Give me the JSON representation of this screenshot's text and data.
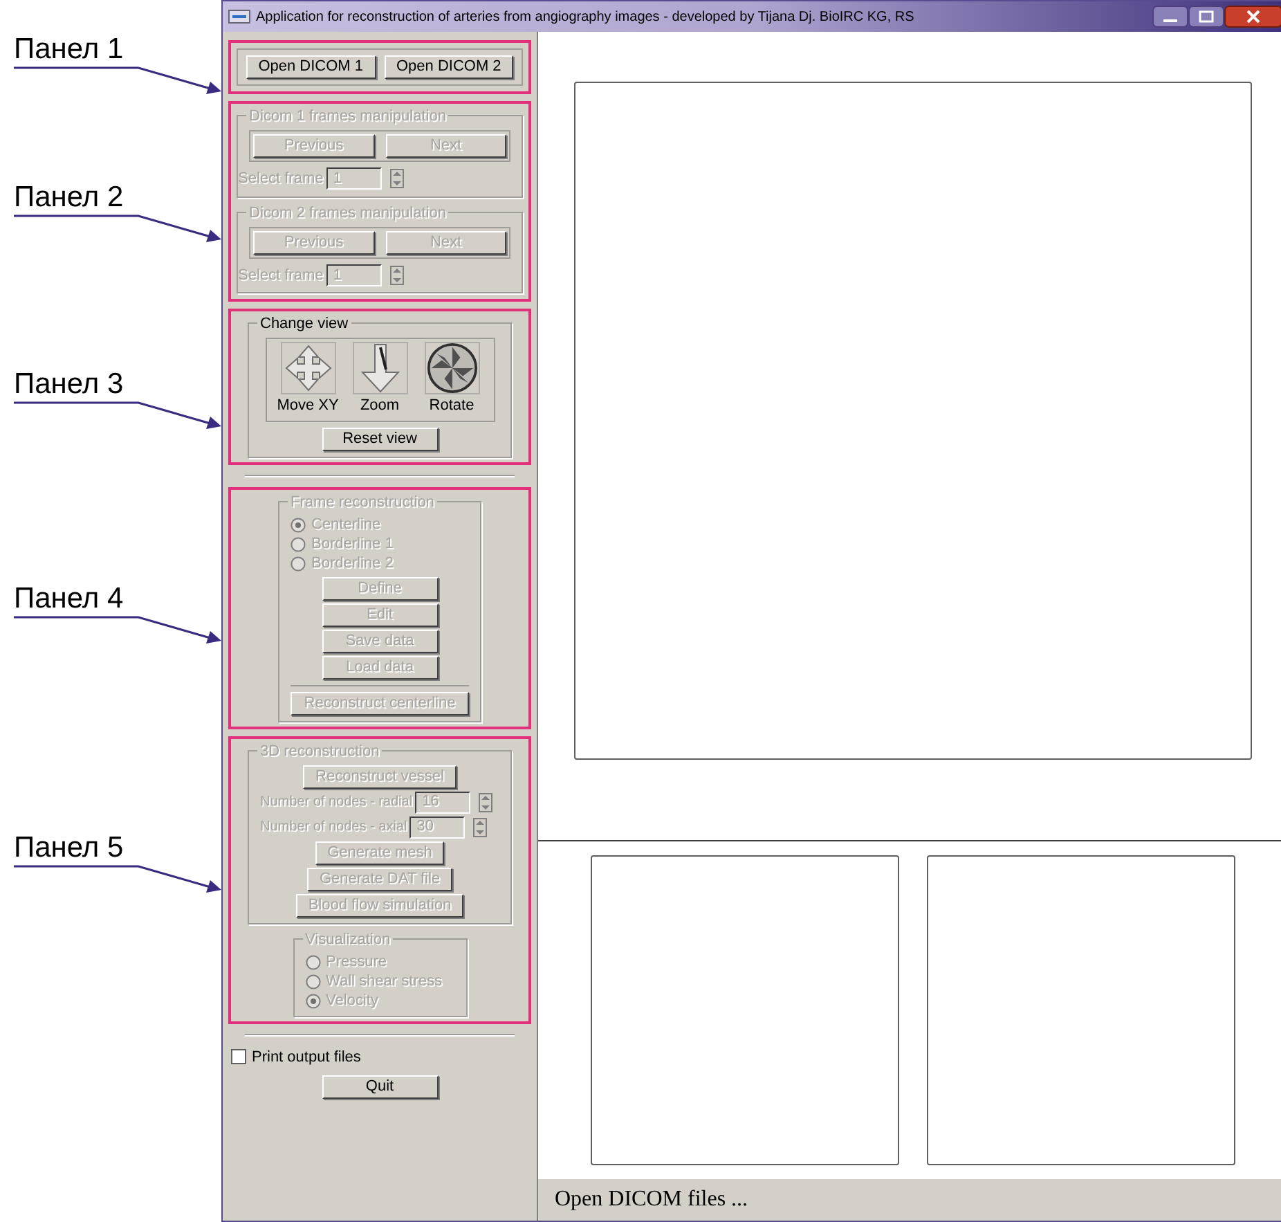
{
  "annotations": [
    {
      "label": "Панел 1"
    },
    {
      "label": "Панел 2"
    },
    {
      "label": "Панел 3"
    },
    {
      "label": "Панел 4"
    },
    {
      "label": "Панел 5"
    }
  ],
  "window": {
    "title": "Application for reconstruction of arteries from angiography images - developed by Tijana Dj. BioIRC KG, RS"
  },
  "open_buttons": [
    "Open DICOM 1",
    "Open DICOM 2"
  ],
  "frame_groups": [
    {
      "title": "Dicom 1 frames manipulation",
      "disabled": true,
      "buttons": [
        "Previous",
        "Next"
      ],
      "select_label": "Select frame",
      "value": "1"
    },
    {
      "title": "Dicom 2 frames manipulation",
      "disabled": true,
      "buttons": [
        "Previous",
        "Next"
      ],
      "select_label": "Select frame",
      "value": "1"
    }
  ],
  "change_view": {
    "title": "Change view",
    "tools": [
      {
        "kind": "move",
        "label": "Move XY"
      },
      {
        "kind": "zoom",
        "label": "Zoom"
      },
      {
        "kind": "rotate",
        "label": "Rotate"
      }
    ],
    "reset": "Reset view"
  },
  "frame_reconstruction": {
    "title": "Frame reconstruction",
    "disabled": true,
    "options": [
      {
        "label": "Centerline",
        "selected": true
      },
      {
        "label": "Borderline 1",
        "selected": false
      },
      {
        "label": "Borderline 2",
        "selected": false
      }
    ],
    "buttons": [
      "Define",
      "Edit",
      "Save data",
      "Load data"
    ],
    "reconstruct": "Reconstruct centerline"
  },
  "reconstruction_3d": {
    "title": "3D reconstruction",
    "disabled": true,
    "reconstruct": "Reconstruct vessel",
    "nodes": [
      {
        "label": "Number of nodes - radial",
        "value": "16"
      },
      {
        "label": "Number of nodes - axial",
        "value": "30"
      }
    ],
    "buttons": [
      "Generate mesh",
      "Generate DAT file",
      "Blood flow simulation"
    ]
  },
  "visualization": {
    "title": "Visualization",
    "disabled": true,
    "options": [
      {
        "label": "Pressure",
        "selected": false
      },
      {
        "label": "Wall shear stress",
        "selected": false
      },
      {
        "label": "Velocity",
        "selected": true
      }
    ]
  },
  "print_output": {
    "label": "Print output files",
    "checked": false
  },
  "quit": "Quit",
  "status_bar": "Open DICOM files ..."
}
